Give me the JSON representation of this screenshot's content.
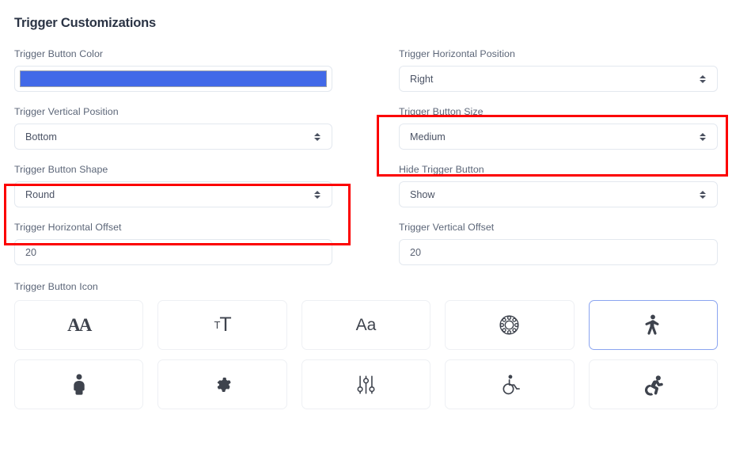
{
  "header": {
    "title": "Trigger Customizations"
  },
  "fields": {
    "trigger_button_color": {
      "label": "Trigger Button Color",
      "value": "#4169e8",
      "type": "color"
    },
    "trigger_horizontal_position": {
      "label": "Trigger Horizontal Position",
      "value": "Right",
      "type": "select"
    },
    "trigger_vertical_position": {
      "label": "Trigger Vertical Position",
      "value": "Bottom",
      "type": "select"
    },
    "trigger_button_size": {
      "label": "Trigger Button Size",
      "value": "Medium",
      "type": "select",
      "highlighted": true
    },
    "trigger_button_shape": {
      "label": "Trigger Button Shape",
      "value": "Round",
      "type": "select",
      "highlighted": true
    },
    "hide_trigger_button": {
      "label": "Hide Trigger Button",
      "value": "Show",
      "type": "select"
    },
    "trigger_horizontal_offset": {
      "label": "Trigger Horizontal Offset",
      "value": "20",
      "type": "text"
    },
    "trigger_vertical_offset": {
      "label": "Trigger Vertical Offset",
      "value": "20",
      "type": "text"
    }
  },
  "icon_picker": {
    "label": "Trigger Button Icon",
    "selected_index": 4,
    "tiles": [
      {
        "icon": "serif-double-a-icon",
        "name": "double-a-serif"
      },
      {
        "icon": "small-t-big-t-icon",
        "name": "text-size"
      },
      {
        "icon": "aa-sans-icon",
        "name": "aa-sans"
      },
      {
        "icon": "accessibility-wheel-icon",
        "name": "accessibility-wheel"
      },
      {
        "icon": "accessibility-person-icon",
        "name": "accessibility-person"
      },
      {
        "icon": "person-solid-icon",
        "name": "person-solid"
      },
      {
        "icon": "gear-icon",
        "name": "settings-gear"
      },
      {
        "icon": "sliders-icon",
        "name": "adjustment-sliders"
      },
      {
        "icon": "wheelchair-icon",
        "name": "wheelchair"
      },
      {
        "icon": "wheelchair-motion-icon",
        "name": "wheelchair-motion"
      }
    ]
  },
  "annotations": {
    "highlight_color": "#fc0000",
    "highlighted_fields": [
      "trigger_button_size",
      "trigger_button_shape"
    ]
  }
}
